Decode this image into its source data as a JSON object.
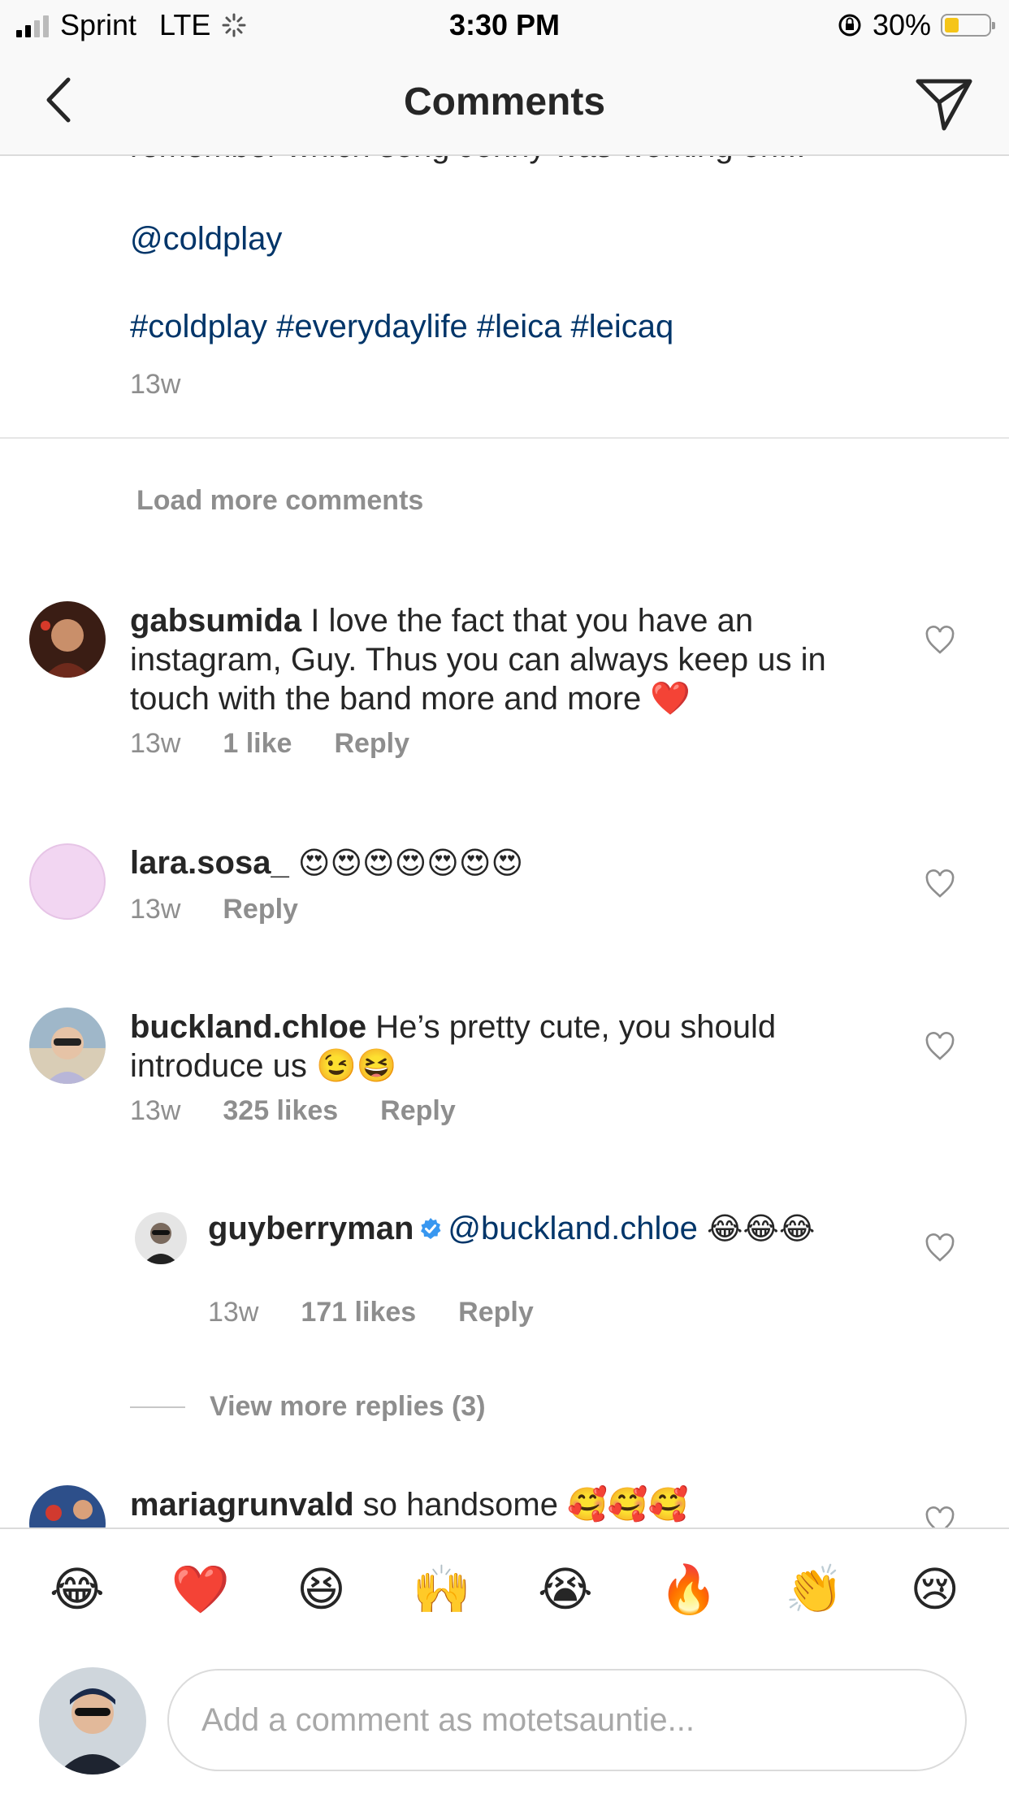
{
  "status_bar": {
    "carrier": "Sprint",
    "network": "LTE",
    "time": "3:30 PM",
    "battery": "30%",
    "battery_fraction": 0.3
  },
  "nav": {
    "title": "Comments",
    "back_icon": "chevron-left-icon",
    "send_icon": "paper-plane-icon"
  },
  "caption": {
    "truncated_text": "remember which song Jonny was working on...",
    "mention": "@coldplay",
    "hashtags": "#coldplay #everydaylife #leica #leicaq",
    "time": "13w"
  },
  "load_more": "Load more comments",
  "comments": [
    {
      "username": "gabsumida",
      "text": "I love the fact that you have an instagram, Guy. Thus you can always keep us in touch with the band more and more ❤️",
      "time": "13w",
      "likes": "1 like",
      "reply": "Reply"
    },
    {
      "username": "lara.sosa_",
      "text": "😍😍😍😍😍😍😍",
      "time": "13w",
      "reply": "Reply"
    },
    {
      "username": "buckland.chloe",
      "text": "He’s pretty cute, you should introduce us 😉😆",
      "time": "13w",
      "likes": "325 likes",
      "reply": "Reply"
    },
    {
      "username": "guyberryman",
      "mention": "@buckland.chloe",
      "text": "😂😂😂",
      "time": "13w",
      "likes": "171 likes",
      "reply": "Reply",
      "verified": true
    },
    {
      "username": "mariagrunvald",
      "text": "so handsome 🥰🥰🥰"
    }
  ],
  "view_more_replies": "View more replies (3)",
  "emoji_bar": [
    "😂",
    "❤️",
    "😆",
    "🙌",
    "😭",
    "🔥",
    "👏",
    "😢"
  ],
  "composer": {
    "placeholder": "Add a comment as motetsauntie..."
  },
  "colors": {
    "link": "#003569",
    "meta": "#8e8e8e",
    "text": "#262626",
    "verified": "#3897f0",
    "battery": "#f5c518"
  }
}
